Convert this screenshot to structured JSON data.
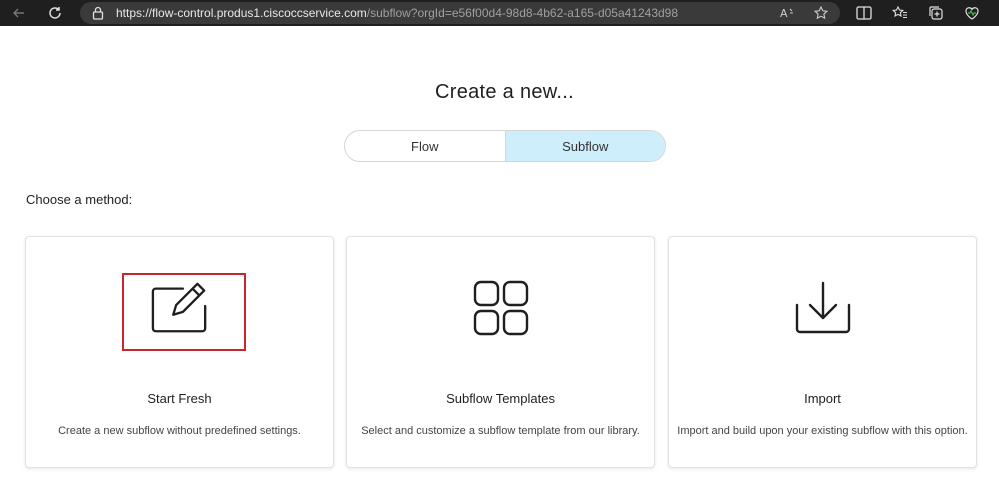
{
  "browser": {
    "url_host": "https://flow-control.produs1.ciscoccservice.com",
    "url_path": "/subflow?orgId=e56f00d4-98d8-4b62-a165-d05a41243d98"
  },
  "page": {
    "title": "Create a new...",
    "toggle": {
      "options": [
        "Flow",
        "Subflow"
      ],
      "selected": "Subflow"
    },
    "method_label": "Choose a method:",
    "cards": [
      {
        "icon": "edit-pencil-icon",
        "title": "Start Fresh",
        "description": "Create a new subflow without predefined settings.",
        "highlighted": true
      },
      {
        "icon": "grid-templates-icon",
        "title": "Subflow Templates",
        "description": "Select and customize a subflow template from our library."
      },
      {
        "icon": "download-import-icon",
        "title": "Import",
        "description": "Import and build upon your existing subflow with this option."
      }
    ]
  },
  "colors": {
    "toggle_active": "#cfeefb",
    "highlight_border": "#c8262e",
    "browser_chrome": "#1f1f1f"
  }
}
